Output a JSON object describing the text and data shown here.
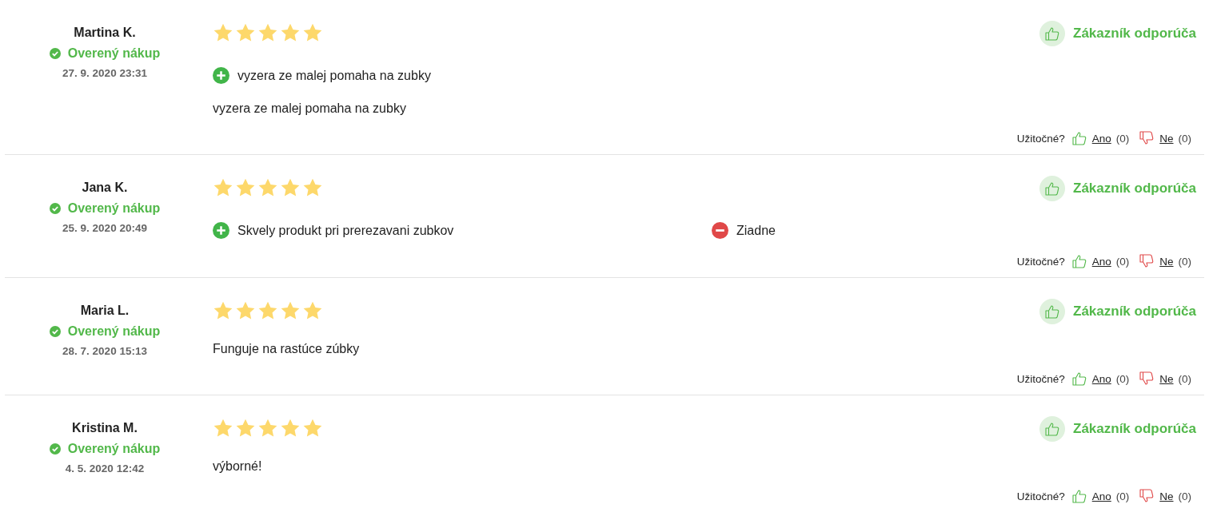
{
  "reviews": [
    {
      "name": "Martina K.",
      "verified": "Overený nákup",
      "date": "27. 9. 2020 23:31",
      "stars": 5,
      "pros": [
        "vyzera ze malej pomaha na zubky"
      ],
      "text": "vyzera ze malej pomaha na zubky",
      "recommend": "Zákazník odporúča",
      "helpful": "Užitočné?",
      "yes": "Ano",
      "yes_count": "(0)",
      "no": "Ne",
      "no_count": "(0)"
    },
    {
      "name": "Jana K.",
      "verified": "Overený nákup",
      "date": "25. 9. 2020 20:49",
      "stars": 5,
      "pros": [
        "Skvely produkt pri prerezavani zubkov"
      ],
      "cons": [
        "Ziadne"
      ],
      "recommend": "Zákazník odporúča",
      "helpful": "Užitočné?",
      "yes": "Ano",
      "yes_count": "(0)",
      "no": "Ne",
      "no_count": "(0)"
    },
    {
      "name": "Maria L.",
      "verified": "Overený nákup",
      "date": "28. 7. 2020 15:13",
      "stars": 5,
      "text": "Funguje na rastúce zúbky",
      "recommend": "Zákazník odporúča",
      "helpful": "Užitočné?",
      "yes": "Ano",
      "yes_count": "(0)",
      "no": "Ne",
      "no_count": "(0)"
    },
    {
      "name": "Kristina M.",
      "verified": "Overený nákup",
      "date": "4. 5. 2020 12:42",
      "stars": 5,
      "text": "výborné!",
      "recommend": "Zákazník odporúča",
      "helpful": "Užitočné?",
      "yes": "Ano",
      "yes_count": "(0)",
      "no": "Ne",
      "no_count": "(0)"
    }
  ]
}
